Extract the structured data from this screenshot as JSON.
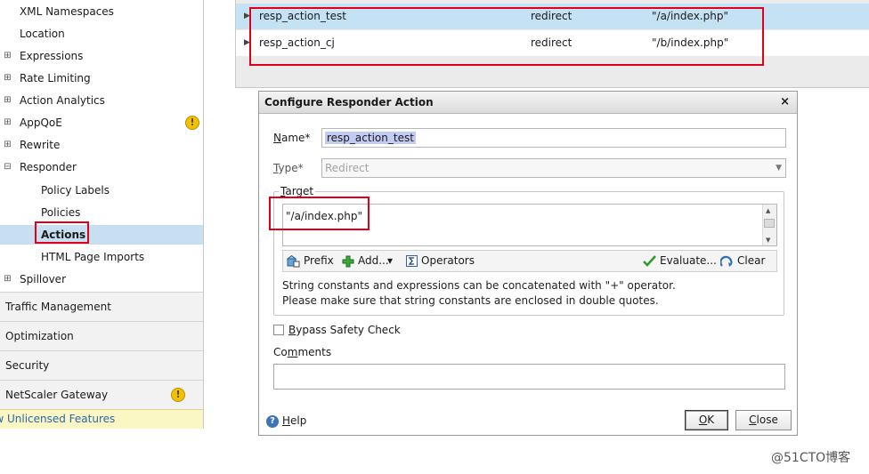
{
  "nav": {
    "items": [
      {
        "label": "XML Namespaces",
        "level": 1,
        "expandable": false
      },
      {
        "label": "Location",
        "level": 1,
        "expandable": false
      },
      {
        "label": "Expressions",
        "level": 1,
        "expandable": true,
        "expanded": false
      },
      {
        "label": "Rate Limiting",
        "level": 1,
        "expandable": true,
        "expanded": false
      },
      {
        "label": "Action Analytics",
        "level": 1,
        "expandable": true,
        "expanded": false
      },
      {
        "label": "AppQoE",
        "level": 1,
        "expandable": true,
        "expanded": false,
        "warning": true
      },
      {
        "label": "Rewrite",
        "level": 1,
        "expandable": true,
        "expanded": false
      },
      {
        "label": "Responder",
        "level": 1,
        "expandable": true,
        "expanded": true
      },
      {
        "label": "Policy Labels",
        "level": 2
      },
      {
        "label": "Policies",
        "level": 2
      },
      {
        "label": "Actions",
        "level": 2,
        "selected": true
      },
      {
        "label": "HTML Page Imports",
        "level": 2
      },
      {
        "label": "Spillover",
        "level": 1,
        "expandable": true,
        "expanded": false
      }
    ],
    "sections": [
      {
        "label": "Traffic Management"
      },
      {
        "label": "Optimization"
      },
      {
        "label": "Security"
      },
      {
        "label": "NetScaler Gateway",
        "warning": true
      }
    ],
    "unlicensed": "ow Unlicensed Features",
    "warning_glyph": "!"
  },
  "list": {
    "rows": [
      {
        "name": "resp_action_test",
        "type": "redirect",
        "target": "\"/a/index.php\"",
        "selected": true
      },
      {
        "name": "resp_action_cj",
        "type": "redirect",
        "target": "\"/b/index.php\"",
        "selected": false
      }
    ],
    "row_arrow": "▶"
  },
  "dialog": {
    "title": "Configure Responder Action",
    "close_glyph": "×",
    "name_label_key": "N",
    "name_label_rest": "ame*",
    "name_value": "resp_action_test",
    "type_label_key": "T",
    "type_label_rest": "ype*",
    "type_value": "Redirect",
    "type_dropdown_glyph": "▼",
    "target_label_key": "T",
    "target_label_rest": "arget",
    "target_value": "\"/a/index.php\"",
    "toolbar": {
      "prefix": "Prefix",
      "add": "Add...",
      "add_dropdown": "▾",
      "operators": "Operators",
      "evaluate": "Evaluate...",
      "clear": "Clear"
    },
    "hint1": "String constants and expressions can be concatenated with \"+\" operator.",
    "hint2": "Please make sure that string constants are enclosed in double quotes.",
    "bypass_key": "B",
    "bypass_rest": "ypass Safety Check",
    "bypass_checked": false,
    "comments_pre": "Co",
    "comments_key": "m",
    "comments_post": "ments",
    "help_glyph": "?",
    "help_key": "H",
    "help_rest": "elp",
    "ok_key": "O",
    "ok_rest": "K",
    "close_key": "C",
    "close_rest": "lose"
  },
  "watermark": "@51CTO博客",
  "colors": {
    "highlight_box": "#e0001b",
    "selected_row": "#c5e2f4",
    "warning": "#f2c200",
    "link": "#2a67a6"
  }
}
